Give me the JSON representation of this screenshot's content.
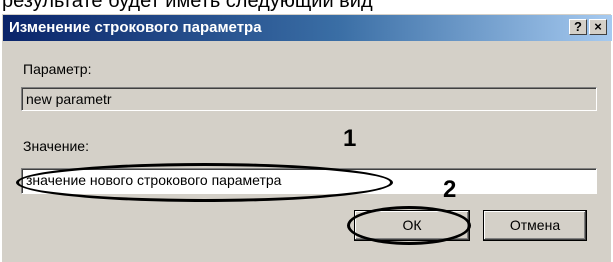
{
  "background_caption": "результате будет иметь следующий вид",
  "dialog": {
    "title": "Изменение строкового параметра",
    "help_button": "?",
    "close_button": "×",
    "parameter_label": "Параметр:",
    "parameter_value": "new parametr",
    "value_label": "Значение:",
    "value_input": "значение нового строкового параметра",
    "ok_label": "ОК",
    "cancel_label": "Отмена"
  },
  "annotations": {
    "marker_1": "1",
    "marker_2": "2"
  },
  "colors": {
    "titlebar_start": "#0a246a",
    "titlebar_end": "#a6caf0",
    "dialog_face": "#d4d0c8"
  }
}
